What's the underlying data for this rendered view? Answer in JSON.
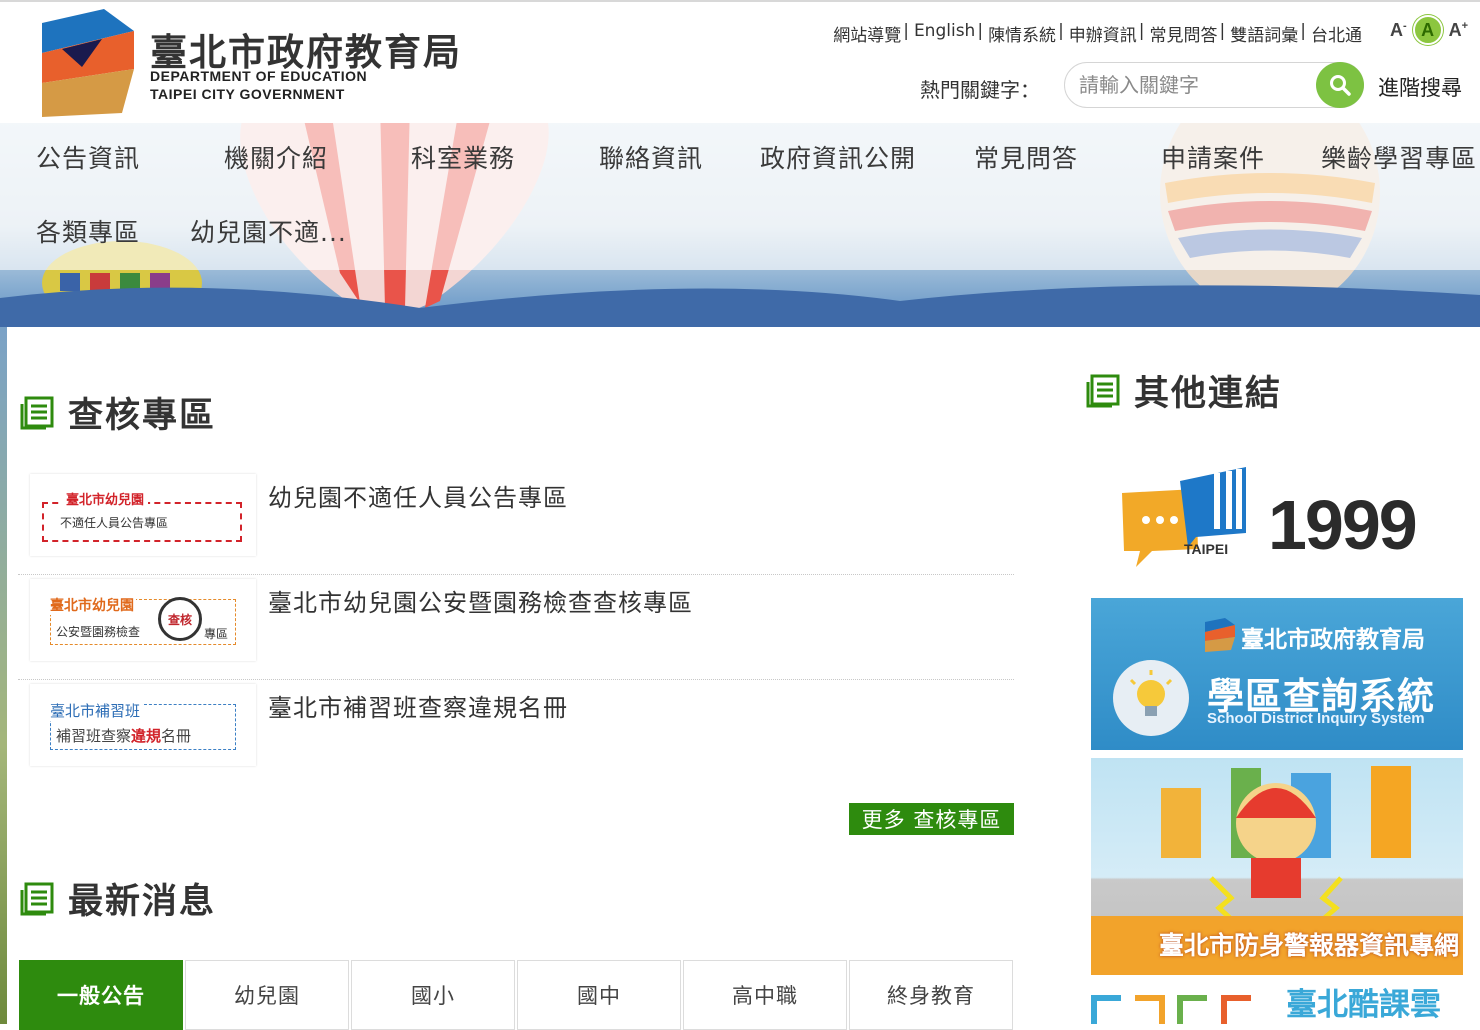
{
  "header": {
    "logo_zh": "臺北市政府教育局",
    "logo_en_line1": "DEPARTMENT OF  EDUCATION",
    "logo_en_line2": "TAIPEI CITY GOVERNMENT",
    "top_links": [
      "網站導覽",
      "English",
      "陳情系統",
      "申辦資訊",
      "常見問答",
      "雙語詞彙",
      "台北通"
    ],
    "top_link_separator": "|",
    "font_size": {
      "small": "A",
      "medium": "A",
      "large": "A",
      "small_mark": "-",
      "large_mark": "+"
    },
    "keyword_label": "熱門關鍵字：",
    "search_placeholder": "請輸入關鍵字",
    "advanced_search": "進階搜尋"
  },
  "nav": {
    "items": [
      "公告資訊",
      "機關介紹",
      "科室業務",
      "聯絡資訊",
      "政府資訊公開",
      "常見問答",
      "申請案件",
      "樂齡學習專區",
      "各類專區",
      "幼兒園不適..."
    ]
  },
  "review_section": {
    "title": "查核專區",
    "items": [
      {
        "title": "幼兒園不適任人員公告專區",
        "thumb_line1": "臺北市幼兒園",
        "thumb_line2": "不適任人員公告專區"
      },
      {
        "title": "臺北市幼兒園公安暨園務檢查查核專區",
        "thumb_line1": "臺北市幼兒園",
        "thumb_line2": "公安暨園務檢查",
        "thumb_badge": "查核",
        "thumb_suffix": "專區"
      },
      {
        "title": "臺北市補習班查察違規名冊",
        "thumb_line1": "臺北市補習班",
        "thumb_line2a": "補習班查察",
        "thumb_line2b": "違規",
        "thumb_line2c": "名冊"
      }
    ],
    "more": "更多 查核專區"
  },
  "news_section": {
    "title": "最新消息",
    "tabs": [
      "一般公告",
      "幼兒園",
      "國小",
      "國中",
      "高中職",
      "終身教育"
    ],
    "active_tab": "一般公告"
  },
  "links_section": {
    "title": "其他連結",
    "ads": [
      {
        "name": "1999",
        "brand": "TAIPEI",
        "number": "1999"
      },
      {
        "name": "school-district",
        "org": "臺北市政府教育局",
        "title": "學區查詢系統",
        "subtitle": "School District Inquiry System"
      },
      {
        "name": "alarm",
        "title": "臺北市防身警報器資訊專網"
      },
      {
        "name": "cool-class",
        "title": "臺北酷課雲"
      }
    ]
  },
  "colors": {
    "green": "#2e8b0e",
    "search_green": "#7dc242",
    "brand_blue": "#1e6fb6",
    "brand_orange": "#e8602c"
  }
}
